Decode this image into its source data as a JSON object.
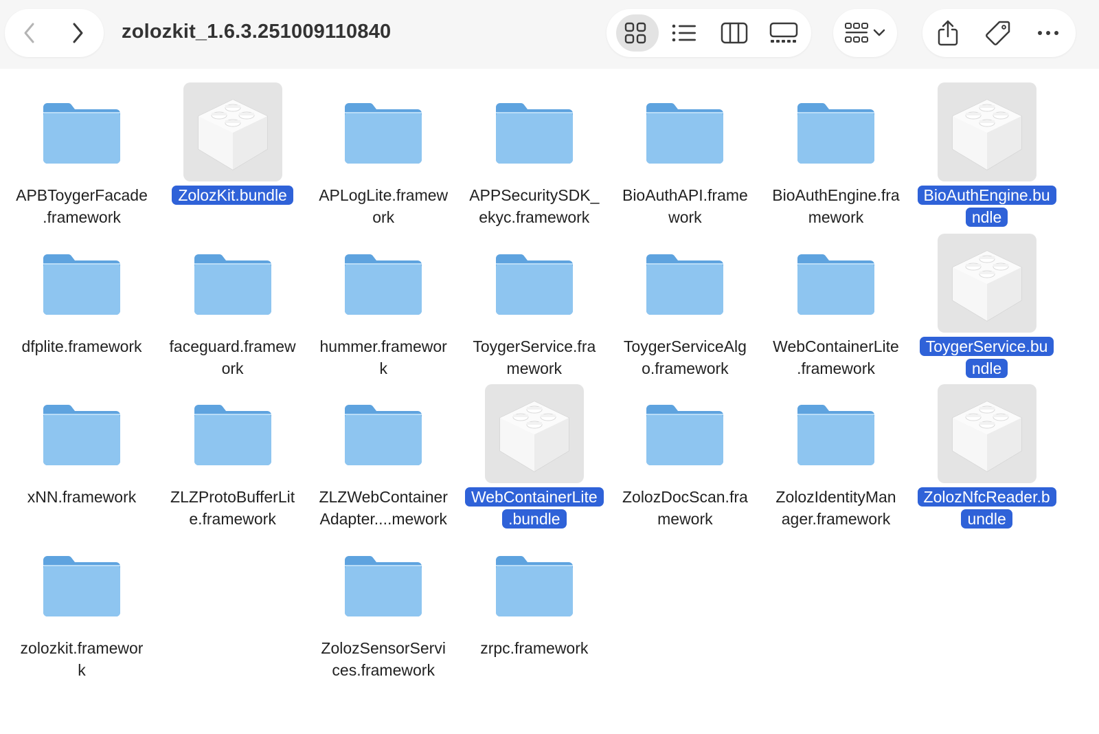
{
  "window": {
    "title": "zolozkit_1.6.3.251009110840"
  },
  "toolbar": {
    "back_icon": "chevron-left-icon",
    "forward_icon": "chevron-right-icon",
    "views": [
      {
        "name": "icon-view",
        "active": true
      },
      {
        "name": "list-view",
        "active": false
      },
      {
        "name": "column-view",
        "active": false
      },
      {
        "name": "gallery-view",
        "active": false
      }
    ],
    "group_icon": "group-grid-icon",
    "actions": [
      "share-icon",
      "tag-icon",
      "more-icon"
    ]
  },
  "colors": {
    "selection": "#2f62d8",
    "folder": "#8ec5f0",
    "folder_dark": "#5ea3df"
  },
  "items": [
    {
      "lines": [
        "APBToygerFacade",
        ".framework"
      ],
      "kind": "folder",
      "selected": false
    },
    {
      "lines": [
        "ZolozKit.bundle"
      ],
      "kind": "bundle",
      "selected": true
    },
    {
      "lines": [
        "APLogLite.framew",
        "ork"
      ],
      "kind": "folder",
      "selected": false
    },
    {
      "lines": [
        "APPSecuritySDK_",
        "ekyc.framework"
      ],
      "kind": "folder",
      "selected": false
    },
    {
      "lines": [
        "BioAuthAPI.frame",
        "work"
      ],
      "kind": "folder",
      "selected": false
    },
    {
      "lines": [
        "BioAuthEngine.fra",
        "mework"
      ],
      "kind": "folder",
      "selected": false
    },
    {
      "lines": [
        "BioAuthEngine.bu",
        "ndle"
      ],
      "kind": "bundle",
      "selected": true
    },
    {
      "lines": [
        "dfplite.framework"
      ],
      "kind": "folder",
      "selected": false
    },
    {
      "lines": [
        "faceguard.framew",
        "ork"
      ],
      "kind": "folder",
      "selected": false
    },
    {
      "lines": [
        "hummer.framewor",
        "k"
      ],
      "kind": "folder",
      "selected": false
    },
    {
      "lines": [
        "ToygerService.fra",
        "mework"
      ],
      "kind": "folder",
      "selected": false
    },
    {
      "lines": [
        "ToygerServiceAlg",
        "o.framework"
      ],
      "kind": "folder",
      "selected": false
    },
    {
      "lines": [
        "WebContainerLite",
        ".framework"
      ],
      "kind": "folder",
      "selected": false
    },
    {
      "lines": [
        "ToygerService.bu",
        "ndle"
      ],
      "kind": "bundle",
      "selected": true
    },
    {
      "lines": [
        "xNN.framework"
      ],
      "kind": "folder",
      "selected": false
    },
    {
      "lines": [
        "ZLZProtoBufferLit",
        "e.framework"
      ],
      "kind": "folder",
      "selected": false
    },
    {
      "lines": [
        "ZLZWebContainer",
        "Adapter....mework"
      ],
      "kind": "folder",
      "selected": false
    },
    {
      "lines": [
        "WebContainerLite",
        ".bundle"
      ],
      "kind": "bundle",
      "selected": true
    },
    {
      "lines": [
        "ZolozDocScan.fra",
        "mework"
      ],
      "kind": "folder",
      "selected": false
    },
    {
      "lines": [
        "ZolozIdentityMan",
        "ager.framework"
      ],
      "kind": "folder",
      "selected": false
    },
    {
      "lines": [
        "ZolozNfcReader.b",
        "undle"
      ],
      "kind": "bundle",
      "selected": true
    },
    {
      "lines": [
        "zolozkit.framewor",
        "k"
      ],
      "kind": "folder",
      "selected": false
    },
    null,
    {
      "lines": [
        "ZolozSensorServi",
        "ces.framework"
      ],
      "kind": "folder",
      "selected": false
    },
    {
      "lines": [
        "zrpc.framework"
      ],
      "kind": "folder",
      "selected": false
    }
  ]
}
